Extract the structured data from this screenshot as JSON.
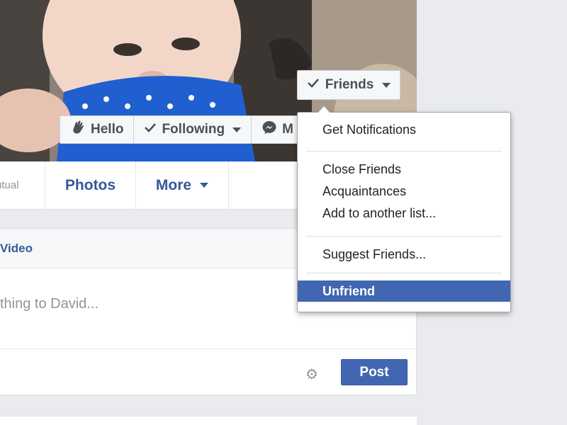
{
  "profile_actions": {
    "hello_label": "Hello",
    "following_label": "Following",
    "message_label": "M"
  },
  "friends_button": {
    "label": "Friends"
  },
  "tabs": {
    "mutual_label": "utual",
    "photos_label": "Photos",
    "more_label": "More"
  },
  "composer": {
    "header_label": "Video",
    "placeholder": "thing to David...",
    "post_label": "Post"
  },
  "friends_menu": {
    "items": [
      {
        "label": "Get Notifications"
      },
      {
        "label": "Close Friends"
      },
      {
        "label": "Acquaintances"
      },
      {
        "label": "Add to another list..."
      },
      {
        "label": "Suggest Friends..."
      },
      {
        "label": "Unfriend"
      }
    ],
    "highlighted_item": "Unfriend"
  },
  "colors": {
    "brand_blue": "#4267b2",
    "link_blue": "#365899",
    "page_bg": "#e9ebee",
    "highlight": "#4267b2"
  },
  "icons": {
    "hello": "waving-hand-icon",
    "check": "check-icon",
    "messenger": "messenger-icon",
    "gear": "gear-icon",
    "caret": "caret-down-icon"
  }
}
